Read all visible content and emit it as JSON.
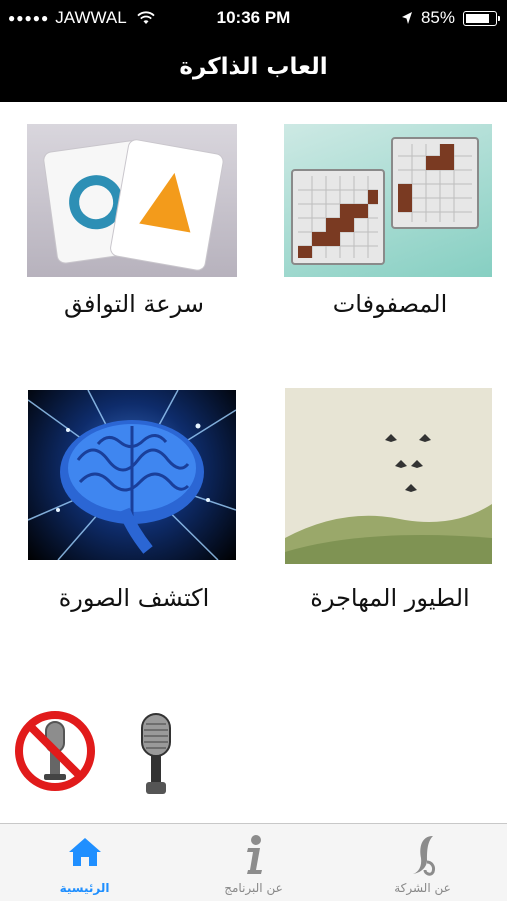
{
  "status_bar": {
    "signal": "●●●●●",
    "carrier": "JAWWAL",
    "time": "10:36 PM",
    "battery_percent": "85%",
    "battery_level": 0.85
  },
  "nav": {
    "title": "العاب الذاكرة"
  },
  "games": [
    {
      "label": "المصفوفات",
      "icon": "matrix-grids-icon"
    },
    {
      "label": "سرعة التوافق",
      "icon": "matching-cards-icon"
    },
    {
      "label": "الطيور المهاجرة",
      "icon": "migrating-birds-icon"
    },
    {
      "label": "اكتشف الصورة",
      "icon": "brain-icon"
    }
  ],
  "sound": {
    "mute_icon": "microphone-muted-icon",
    "on_icon": "microphone-icon"
  },
  "tabs": [
    {
      "label": "الرئيسية",
      "icon": "home-icon",
      "active": true
    },
    {
      "label": "عن البرنامج",
      "icon": "info-icon",
      "active": false
    },
    {
      "label": "عن الشركة",
      "icon": "company-logo-icon",
      "active": false
    }
  ],
  "colors": {
    "accent": "#1f8fff",
    "bar": "#000000"
  }
}
